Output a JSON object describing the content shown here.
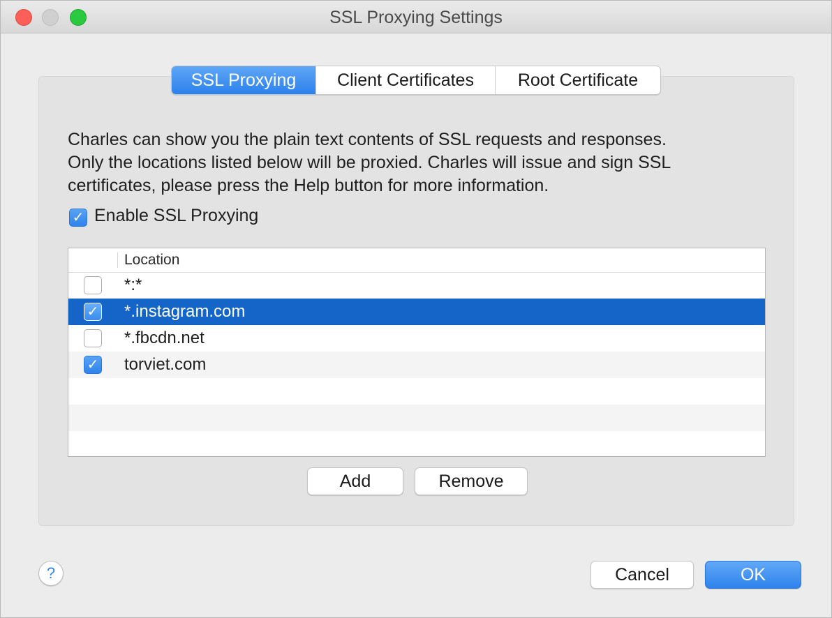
{
  "window": {
    "title": "SSL Proxying Settings"
  },
  "tabs": [
    {
      "label": "SSL Proxying",
      "active": true
    },
    {
      "label": "Client Certificates",
      "active": false
    },
    {
      "label": "Root Certificate",
      "active": false
    }
  ],
  "description": {
    "line1": "Charles can show you the plain text contents of SSL requests and responses.",
    "line2": "Only the locations listed below will be proxied. Charles will issue and sign SSL",
    "line3": "certificates, please press the Help button for more information."
  },
  "enable_ssl": {
    "label": "Enable SSL Proxying",
    "checked": true
  },
  "table": {
    "column_header": "Location",
    "rows": [
      {
        "location": "*:*",
        "enabled": false,
        "selected": false
      },
      {
        "location": "*.instagram.com",
        "enabled": true,
        "selected": true
      },
      {
        "location": "*.fbcdn.net",
        "enabled": false,
        "selected": false
      },
      {
        "location": "torviet.com",
        "enabled": true,
        "selected": false
      }
    ]
  },
  "buttons": {
    "add": "Add",
    "remove": "Remove",
    "cancel": "Cancel",
    "ok": "OK",
    "help": "?"
  },
  "colors": {
    "accent": "#2f83ec",
    "selection": "#1565c9"
  },
  "icons": {
    "checkmark": "✓",
    "help": "question-mark-icon"
  }
}
